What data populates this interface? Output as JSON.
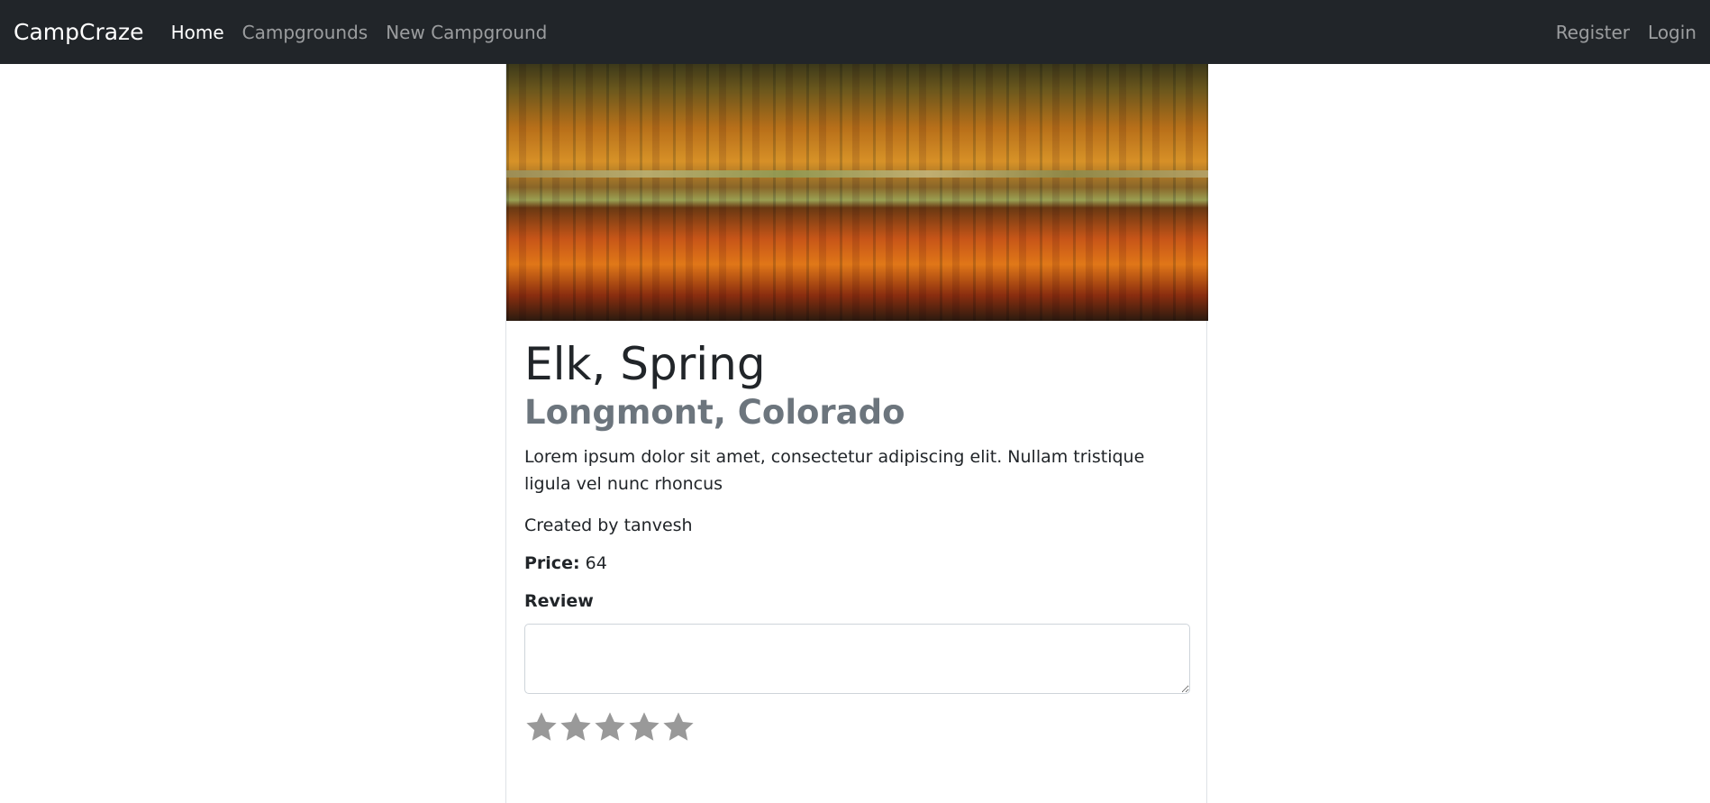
{
  "navbar": {
    "brand": "CampCraze",
    "links": [
      {
        "label": "Home",
        "active": true
      },
      {
        "label": "Campgrounds",
        "active": false
      },
      {
        "label": "New Campground",
        "active": false
      }
    ],
    "right_links": [
      {
        "label": "Register"
      },
      {
        "label": "Login"
      }
    ]
  },
  "campground": {
    "title": "Elk, Spring",
    "location": "Longmont, Colorado",
    "description": "Lorem ipsum dolor sit amet, consectetur adipiscing elit. Nullam tristique ligula vel nunc rhoncus",
    "created_by": "Created by tanvesh",
    "price_label": "Price:",
    "price_value": "64"
  },
  "review": {
    "label": "Review",
    "value": "",
    "rating": 0,
    "max_rating": 5
  },
  "colors": {
    "navbar_bg": "#212529",
    "nav_link": "rgba(255,255,255,0.55)",
    "subtitle": "#6c757d",
    "star": "#999999"
  }
}
